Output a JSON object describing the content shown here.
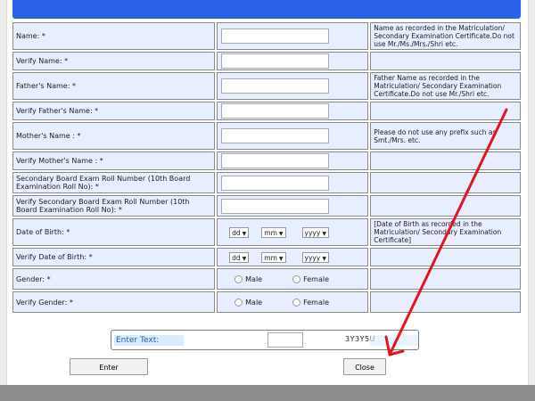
{
  "form": {
    "rows": [
      {
        "label": "Name: *",
        "field": "text",
        "help": "Name as recorded in the Matriculation/ Secondary Examination Certificate.Do not use Mr./Ms./Mrs./Shri etc."
      },
      {
        "label": "Verify Name: *",
        "field": "text",
        "help": ""
      },
      {
        "label": "Father's Name: *",
        "field": "text",
        "help": "Father Name as recorded in the Matriculation/ Secondary Examination Certificate.Do not use Mr./Shri etc."
      },
      {
        "label": "Verify Father's Name: *",
        "field": "text",
        "help": ""
      },
      {
        "label": "Mother's Name : *",
        "field": "text",
        "help": "Please do not use any prefix such as Smt./Mrs. etc."
      },
      {
        "label": "Verify Mother's Name : *",
        "field": "text",
        "help": ""
      },
      {
        "label": "Secondary Board Exam Roll Number (10th Board Examination Roll No): *",
        "field": "text",
        "help": ""
      },
      {
        "label": "Verify Secondary Board Exam Roll Number (10th Board Examination Roll No): *",
        "field": "text",
        "help": ""
      },
      {
        "label": "Date of Birth: *",
        "field": "date",
        "help": "[Date of Birth as recorded in the Matriculation/ Secondary Examination Certificate]"
      },
      {
        "label": "Verify Date of Birth: *",
        "field": "date",
        "help": ""
      },
      {
        "label": "Gender: *",
        "field": "gender",
        "help": ""
      },
      {
        "label": "Verify Gender: *",
        "field": "gender",
        "help": ""
      }
    ],
    "date_selects": {
      "day": "dd",
      "month": "mm",
      "year": "yyyy"
    },
    "gender_options": [
      "Male",
      "Female"
    ]
  },
  "captcha": {
    "label": "Enter Text:",
    "code": "3Y3Y5U"
  },
  "buttons": {
    "enter": "Enter",
    "close": "Close"
  },
  "colors": {
    "header": "#2b63e8",
    "cell_bg": "#e6eeff",
    "annotation_arrow": "#e8141c"
  }
}
